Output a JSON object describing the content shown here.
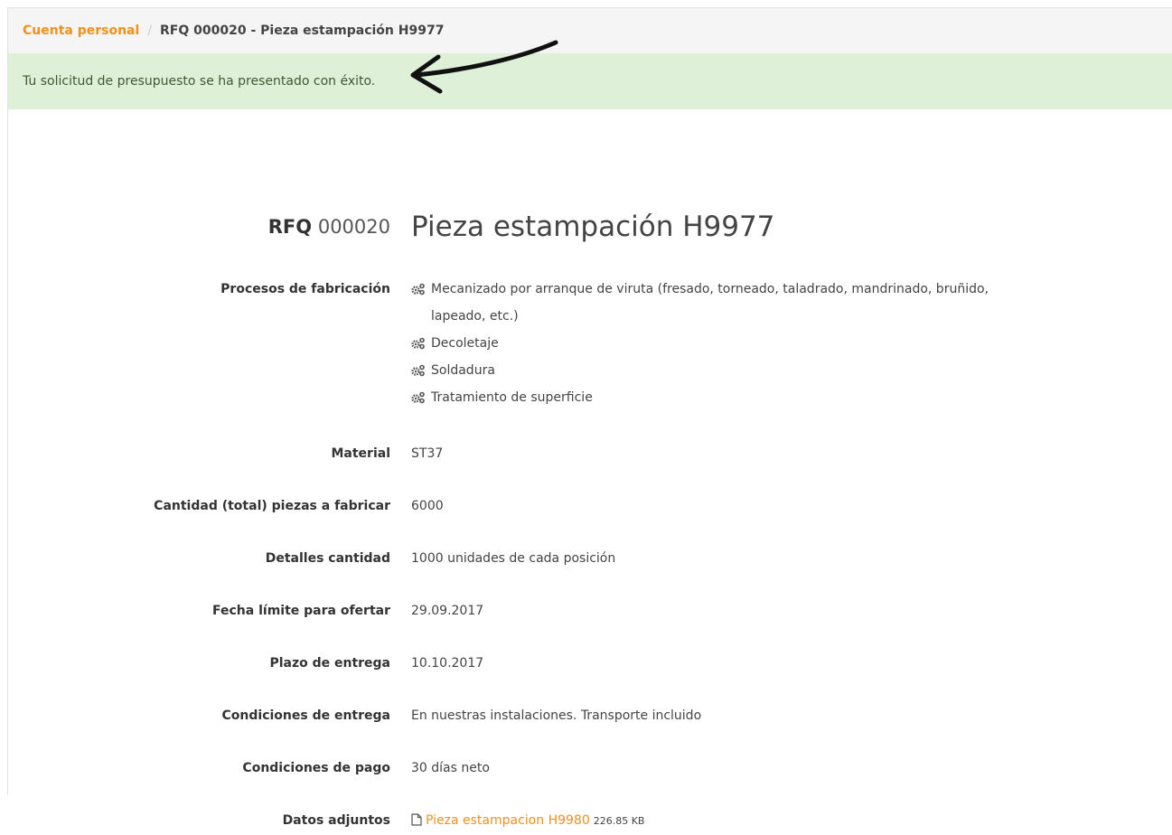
{
  "breadcrumb": {
    "root_label": "Cuenta personal",
    "separator": "/",
    "current_label": "RFQ 000020 - Pieza estampación H9977"
  },
  "alert": {
    "message": "Tu solicitud de presupuesto se ha presentado con éxito."
  },
  "rfq": {
    "prefix": "RFQ",
    "number": "000020",
    "title": "Pieza estampación H9977"
  },
  "fields": {
    "processes": {
      "label": "Procesos de fabricación",
      "items": [
        "Mecanizado por arranque de viruta (fresado, torneado, taladrado, mandrinado, bruñido, lapeado, etc.)",
        "Decoletaje",
        "Soldadura",
        "Tratamiento de superficie"
      ]
    },
    "material": {
      "label": "Material",
      "value": "ST37"
    },
    "quantity": {
      "label": "Cantidad (total) piezas a fabricar",
      "value": "6000"
    },
    "quantity_details": {
      "label": "Detalles cantidad",
      "value": "1000 unidades de cada posición"
    },
    "deadline": {
      "label": "Fecha límite para ofertar",
      "value": "29.09.2017"
    },
    "delivery_time": {
      "label": "Plazo de entrega",
      "value": "10.10.2017"
    },
    "delivery_conditions": {
      "label": "Condiciones de entrega",
      "value": "En nuestras instalaciones. Transporte incluido"
    },
    "payment_conditions": {
      "label": "Condiciones de pago",
      "value": "30 días neto"
    },
    "attachments": {
      "label": "Datos adjuntos",
      "file_name": "Pieza estampacion H9980",
      "file_size": "226.85 KB"
    }
  },
  "colors": {
    "accent": "#f0911e",
    "alert_bg": "#dff0d8",
    "breadcrumb_bg": "#f5f5f5"
  },
  "icons": {
    "process": "gears-icon",
    "attachment": "file-icon",
    "annotation": "arrow-annotation"
  }
}
